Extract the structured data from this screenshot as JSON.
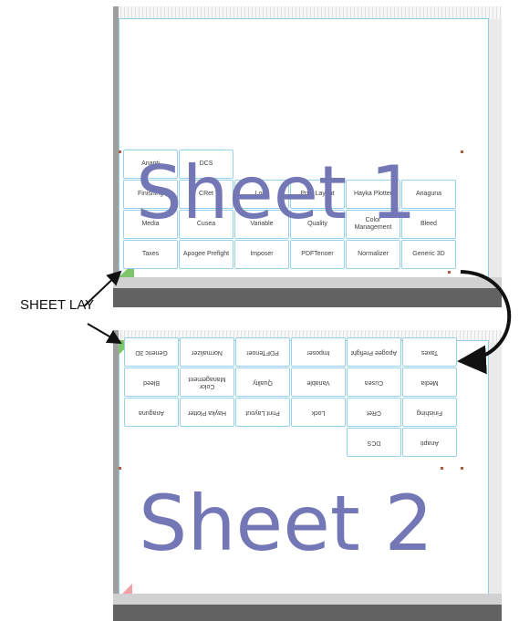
{
  "caption": "SHEET LAY",
  "sheet_1": {
    "title": "Sheet 1",
    "rows": [
      [
        "Anapti",
        "DCS",
        "",
        "",
        "",
        ""
      ],
      [
        "Finishing",
        "CRet",
        "Lock",
        "Print Layout",
        "Hayka Plotter",
        "Anaguna"
      ],
      [
        "Media",
        "Cusea",
        "Variable",
        "Quality",
        "Color Management",
        "Bleed"
      ],
      [
        "Taxes",
        "Apogee Prefight",
        "Imposer",
        "PDFTenoer",
        "Normalizer",
        "Generic 3D"
      ]
    ]
  },
  "sheet_2": {
    "title": "Sheet 2",
    "rows": [
      [
        "Anapti",
        "DCS",
        "",
        "",
        "",
        ""
      ],
      [
        "Finishing",
        "CRet",
        "Lock",
        "Print Layout",
        "Hayka Plotter",
        "Anaguna"
      ],
      [
        "Media",
        "Cusea",
        "Variable",
        "Quality",
        "Color Management",
        "Bleed"
      ],
      [
        "Taxes",
        "Apogee Prefight",
        "Imposer",
        "PDFTenoer",
        "Normalizer",
        "Generic 3D"
      ]
    ]
  },
  "colors": {
    "sheet_text": "#7275b4",
    "frame_gray": "#626262",
    "light_gray": "#d1d1d1",
    "tile_border": "#98d2e8",
    "accent_green": "#7ec46b",
    "accent_red": "#f2a1a8"
  }
}
